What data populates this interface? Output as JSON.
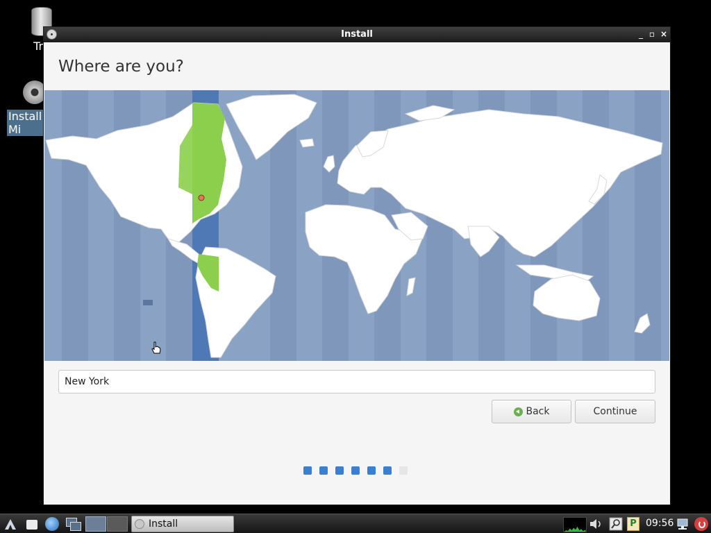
{
  "desktop": {
    "icons": [
      {
        "label": "Tra",
        "icon": "trash-icon"
      },
      {
        "label": "Install\nMi",
        "icon": "disc-icon"
      }
    ]
  },
  "window": {
    "title": "Install",
    "heading": "Where are you?",
    "location": {
      "value": "New York"
    },
    "buttons": {
      "back": "Back",
      "continue": "Continue"
    },
    "progress": {
      "completed_steps": 6,
      "total_steps": 7
    },
    "map": {
      "selected_timezone_color": "#8ccf4d",
      "selected_band_color": "#4f79b5",
      "ocean_color": "#8aa2c4",
      "land_color": "#ffffff",
      "marker": "New York"
    }
  },
  "taskbar": {
    "task_label": "Install",
    "clock": "09:56",
    "tray_icons": [
      "cpu-graph-icon",
      "volume-icon",
      "search-icon",
      "pidgin-icon",
      "network-icon",
      "power-icon"
    ]
  }
}
